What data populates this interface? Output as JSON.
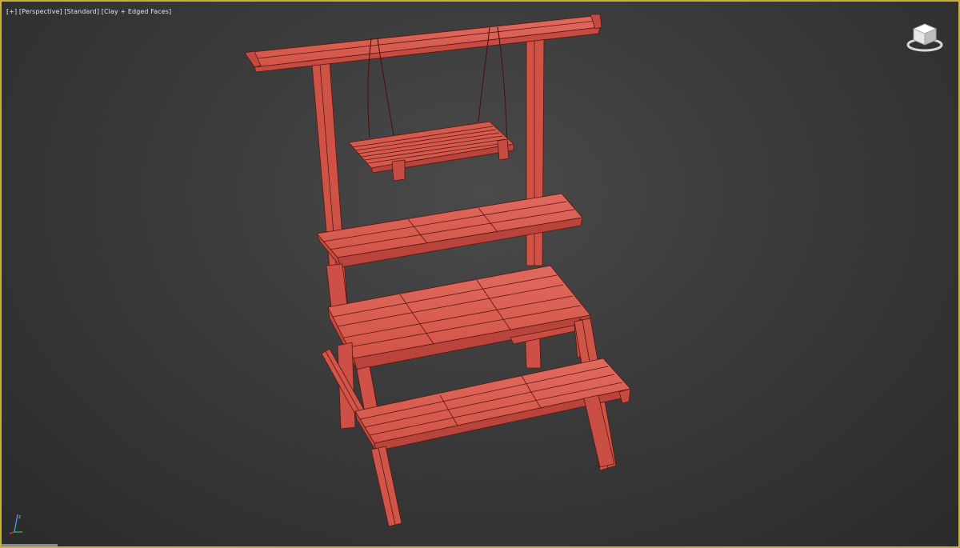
{
  "viewport": {
    "label_plus": "[+]",
    "label_view": "[Perspective]",
    "label_shading": "[Standard]",
    "label_mode": "[Clay + Edged Faces]"
  },
  "model": {
    "name": "play-structure-with-swing",
    "color": "#d85a50",
    "edge_color": "#5a1510"
  },
  "colors": {
    "border_highlight": "#c8b23a",
    "background": "#3a3a3a"
  },
  "icons": {
    "viewcube": "viewcube-icon",
    "axis": "axis-tripod-icon"
  }
}
